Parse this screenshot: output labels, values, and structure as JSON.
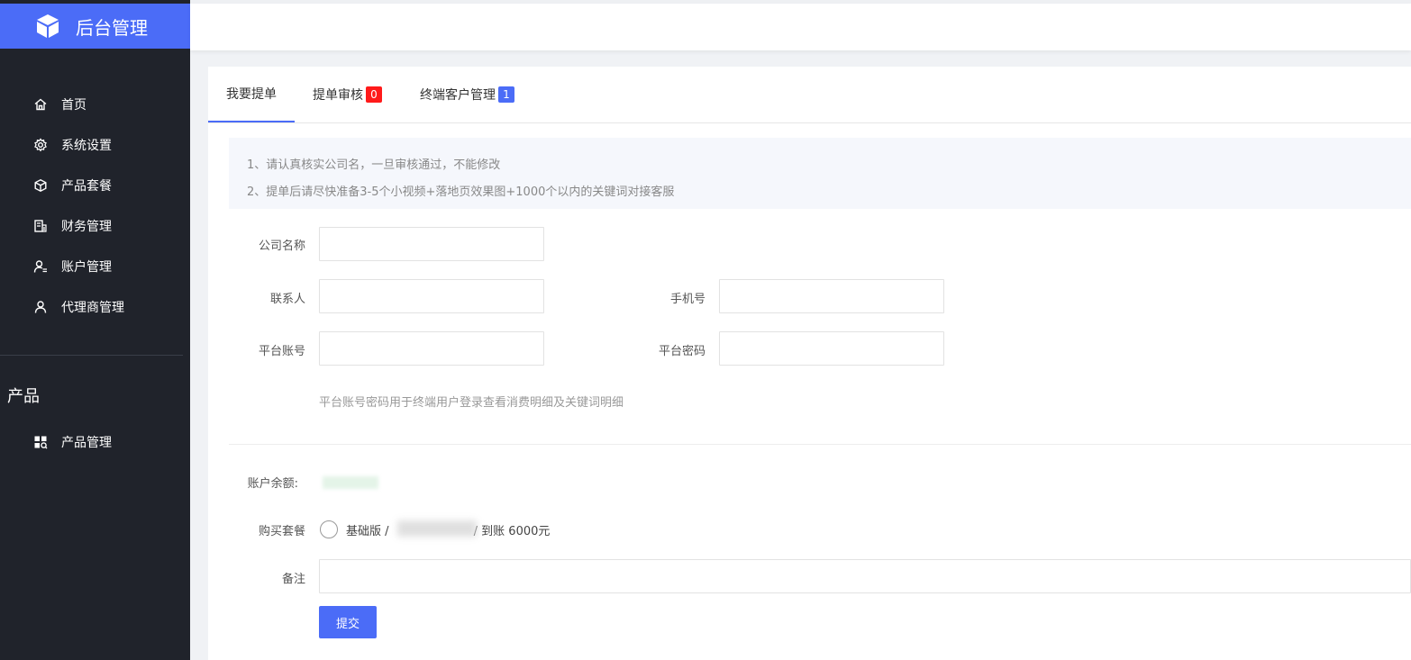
{
  "app": {
    "title": "后台管理",
    "brand_color": "#4b6cf7"
  },
  "sidebar": {
    "items": [
      {
        "label": "首页",
        "icon": "home-icon"
      },
      {
        "label": "系统设置",
        "icon": "gear-icon"
      },
      {
        "label": "产品套餐",
        "icon": "box-icon"
      },
      {
        "label": "财务管理",
        "icon": "ledger-icon"
      },
      {
        "label": "账户管理",
        "icon": "user-settings-icon"
      },
      {
        "label": "代理商管理",
        "icon": "user-icon"
      }
    ],
    "section_title": "产品",
    "section_items": [
      {
        "label": "产品管理",
        "icon": "grid-search-icon"
      }
    ]
  },
  "tabs": [
    {
      "label": "我要提单",
      "badge": ""
    },
    {
      "label": "提单审核",
      "badge": "0",
      "badge_color": "#ff1a1a"
    },
    {
      "label": "终端客户管理",
      "badge": "1",
      "badge_color": "#4b6cf7"
    }
  ],
  "notice": {
    "line1": "1、请认真核实公司名，一旦审核通过，不能修改",
    "line2": "2、提单后请尽快准备3-5个小视频+落地页效果图+1000个以内的关键词对接客服"
  },
  "form": {
    "company_label": "公司名称",
    "contact_label": "联系人",
    "phone_label": "手机号",
    "account_label": "平台账号",
    "password_label": "平台密码",
    "account_hint": "平台账号密码用于终端用户登录查看消费明细及关键词明细",
    "balance_label": "账户余额:",
    "package_label": "购买套餐",
    "package_prefix": "基础版 / ",
    "package_suffix": "/ 到账 6000元",
    "remark_label": "备注",
    "submit_label": "提交"
  }
}
